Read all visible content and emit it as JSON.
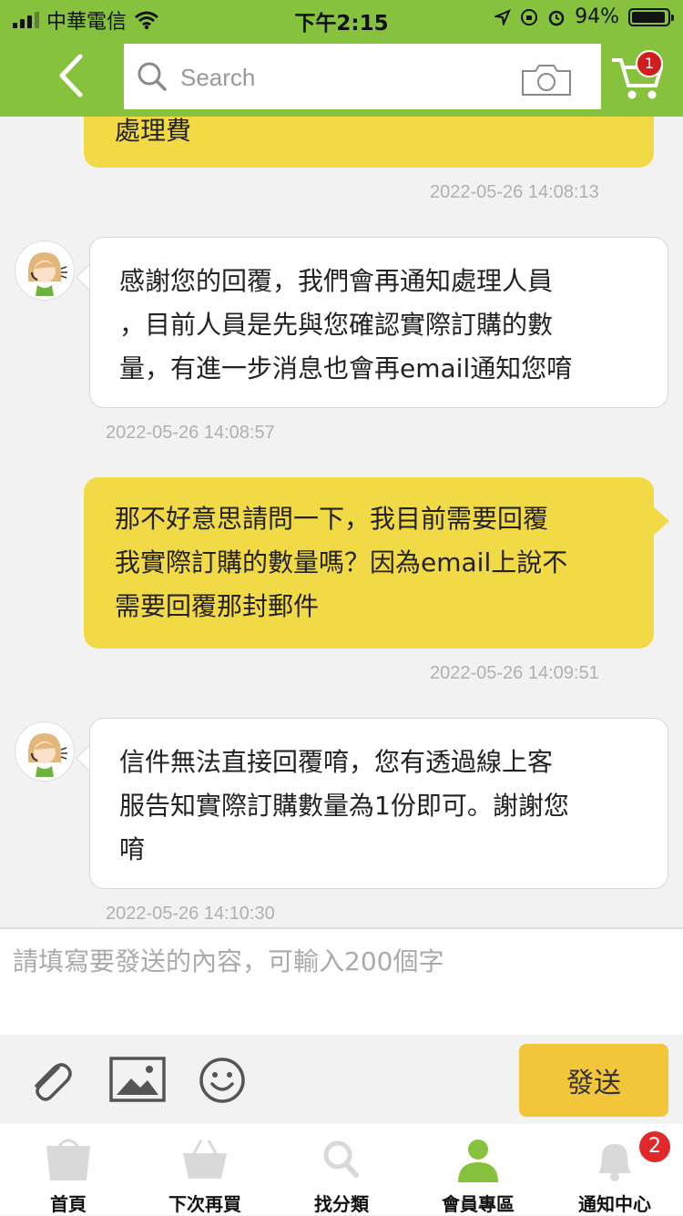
{
  "status_bar": {
    "carrier": "中華電信",
    "time": "下午2:15",
    "battery": "94%",
    "battery_level": 0.94
  },
  "header": {
    "search_placeholder": "Search",
    "cart_count": "1"
  },
  "messages": [
    {
      "side": "out",
      "text": "處理費",
      "time": "2022-05-26 14:08:13"
    },
    {
      "side": "in",
      "lines": [
        "感謝您的回覆，我們會再通知處理人員",
        "，目前人員是先與您確認實際訂購的數",
        "量，有進一步消息也會再email通知您唷"
      ],
      "time": "2022-05-26 14:08:57"
    },
    {
      "side": "out",
      "lines": [
        "那不好意思請問一下，我目前需要回覆",
        "我實際訂購的數量嗎？因為email上說不",
        "需要回覆那封郵件"
      ],
      "time": "2022-05-26 14:09:51"
    },
    {
      "side": "in",
      "lines": [
        "信件無法直接回覆唷，您有透過線上客",
        "服告知實際訂購數量為1份即可。謝謝您",
        "唷"
      ],
      "time": "2022-05-26 14:10:30"
    }
  ],
  "composer": {
    "placeholder": "請填寫要發送的內容，可輸入200個字",
    "send_label": "發送"
  },
  "tabbar": {
    "items": [
      {
        "label": "首頁",
        "icon": "shopping-bag-icon"
      },
      {
        "label": "下次再買",
        "icon": "basket-icon"
      },
      {
        "label": "找分類",
        "icon": "search-icon"
      },
      {
        "label": "會員專區",
        "icon": "person-icon",
        "active": true
      },
      {
        "label": "通知中心",
        "icon": "bell-icon",
        "badge": "2"
      }
    ]
  },
  "colors": {
    "brand_green": "#86c23e",
    "outgoing_bubble": "#f2da47",
    "send_button": "#f3c53a",
    "badge_red": "#e02a2a"
  }
}
